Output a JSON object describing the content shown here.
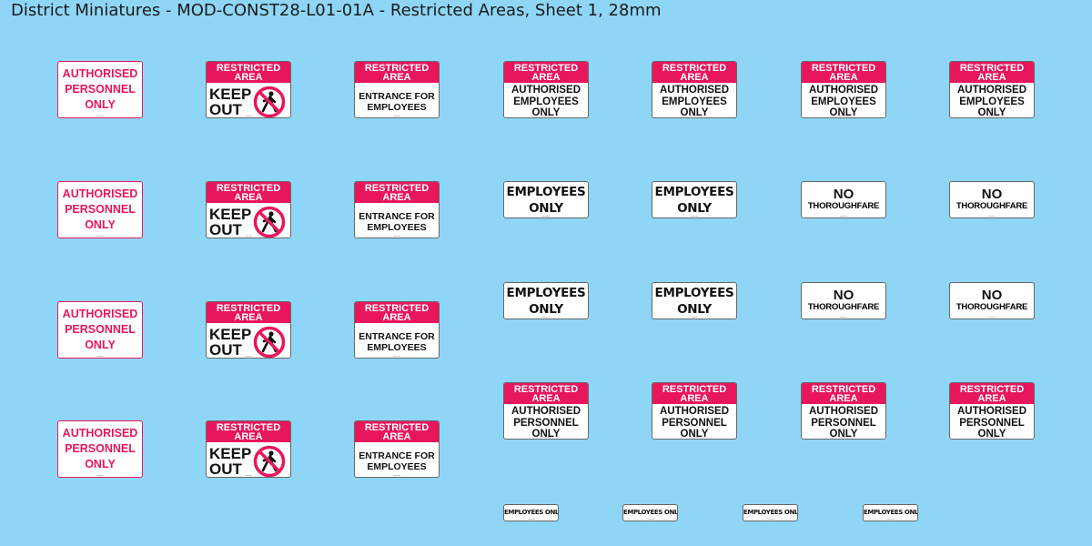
{
  "title": "District Miniatures - MOD-CONST28-L01-01A - Restricted Areas, Sheet 1, 28mm",
  "colors": {
    "background": "#8fd6f6",
    "accent": "#e8175d"
  },
  "signs": {
    "restricted": {
      "line1": "RESTRICTED",
      "line2": "AREA"
    },
    "authorised_personnel_only": {
      "line1": "AUTHORISED",
      "line2": "PERSONNEL",
      "line3": "ONLY"
    },
    "keep_out": {
      "line1": "KEEP",
      "line2": "OUT",
      "icon": "no-pedestrian-icon"
    },
    "entrance_for_employees": {
      "line1": "ENTRANCE FOR",
      "line2": "EMPLOYEES"
    },
    "authorised_employees_only": {
      "line1": "AUTHORISED",
      "line2": "EMPLOYEES",
      "line3": "ONLY"
    },
    "employees_only": {
      "line1": "EMPLOYEES",
      "line2": "ONLY"
    },
    "no_thoroughfare": {
      "line1": "NO",
      "line2": "THOROUGHFARE"
    },
    "employees_only_small": {
      "text": "EMPLOYEES ONLY"
    }
  }
}
